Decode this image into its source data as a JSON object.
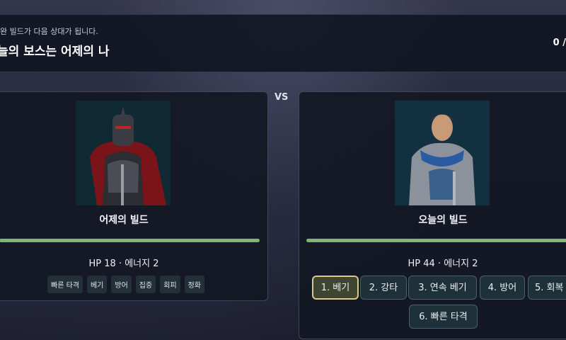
{
  "header": {
    "subtitle": "완 빌드가 다음 상대가 됩니다.",
    "title": "늘의 보스는 어제의 나",
    "score": "0 /"
  },
  "versus_label": "VS",
  "left_fighter": {
    "name": "어제의 빌드",
    "hp_fraction": 1.0,
    "stats": "HP 18 · 에너지 2",
    "skills": [
      "빠른 타격",
      "베기",
      "방어",
      "집중",
      "회피",
      "정화"
    ]
  },
  "right_fighter": {
    "name": "오늘의 빌드",
    "hp_fraction": 1.0,
    "stats": "HP 44 · 에너지 2",
    "skills": [
      "1. 베기",
      "2. 강타",
      "3. 연속 베기",
      "4. 방어",
      "5. 회복",
      "6. 빠른 타격"
    ],
    "selected_skill_index": 0
  },
  "colors": {
    "hp_fill": "#7cb773",
    "selected_border": "#d9c98a",
    "panel_bg": "#14182a"
  }
}
